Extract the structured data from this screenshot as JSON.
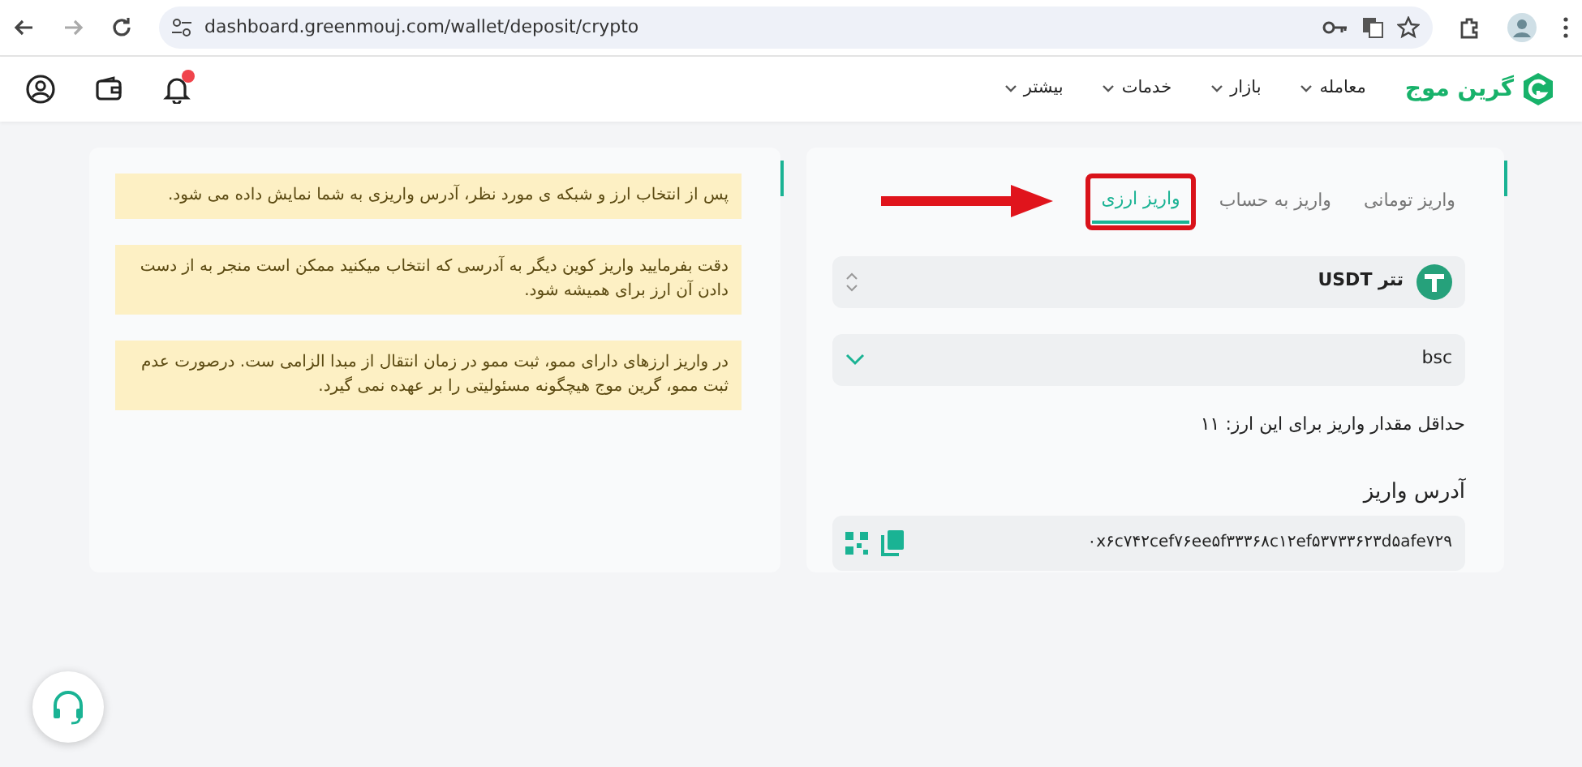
{
  "browser": {
    "url": "dashboard.greenmouj.com/wallet/deposit/crypto"
  },
  "header": {
    "logo_text": "گرین موج",
    "menu": [
      {
        "label": "معامله"
      },
      {
        "label": "بازار"
      },
      {
        "label": "خدمات"
      },
      {
        "label": "بیشتر"
      }
    ],
    "unread_notifications": true
  },
  "deposit": {
    "tabs": [
      {
        "label": "واریز تومانی",
        "selected": false,
        "highlighted": false
      },
      {
        "label": "واریز به حساب",
        "selected": false,
        "highlighted": false
      },
      {
        "label": "واریز ارزی",
        "selected": true,
        "highlighted": true
      }
    ],
    "coin": "تتر USDT",
    "network": "bsc",
    "min_amount": "حداقل مقدار واریز برای این ارز: ۱۱",
    "address_label": "آدرس واریز",
    "address": "۰x۶c۷۴۲cef۷۶ee۵f۳۳۳۶۸c۱۲ef۵۳۷۳۳۶۲۳d۵afe۷۲۹"
  },
  "notes": [
    "پس از انتخاب ارز و شبکه ی مورد نظر، آدرس واریزی به شما نمایش داده می شود.",
    "دقت بفرمایید واریز کوین دیگر به آدرسی که انتخاب میکنید ممکن است منجر به از دست دادن آن ارز برای همیشه شود.",
    "در واریز ارزهای دارای ممو، ثبت ممو در زمان انتقال از مبدا الزامی ست. درصورت عدم ثبت ممو، گرین موج هیچگونه مسئولیتی را بر عهده نمی گیرد."
  ]
}
